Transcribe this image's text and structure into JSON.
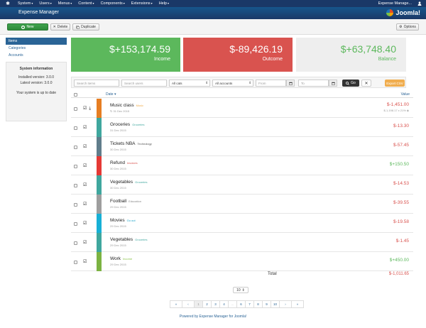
{
  "menubar": {
    "items": [
      "System",
      "Users",
      "Menus",
      "Content",
      "Components",
      "Extensions",
      "Help"
    ],
    "right_label": "Expense Manage..."
  },
  "titlebar": {
    "title": "Expense Manager",
    "brand": "Joomla!"
  },
  "toolbar": {
    "new": "New",
    "delete": "Delete",
    "duplicate": "Duplicate",
    "options": "Options"
  },
  "sidebar": {
    "items": [
      "Items",
      "Categories",
      "Accounts"
    ],
    "system_info": {
      "heading": "System information",
      "installed": "Installed version: 3.0.0",
      "latest": "Latest version: 3.0.0",
      "status": "Your system is up to date"
    }
  },
  "summary": {
    "income": {
      "amount": "$+153,174.59",
      "label": "Income"
    },
    "outcome": {
      "amount": "$-89,426.19",
      "label": "Outcome"
    },
    "balance": {
      "amount": "$+63,748.40",
      "label": "Balance"
    }
  },
  "filters": {
    "search_items_placeholder": "Search items",
    "search_users_placeholder": "Search users",
    "cats_value": "All cats",
    "accounts_value": "All accounts",
    "from_placeholder": "From",
    "to_placeholder": "To",
    "go": "Go",
    "export": "Export CSV"
  },
  "table": {
    "date_header": "Date",
    "value_header": "Value",
    "rows": [
      {
        "name": "Music class",
        "category": "Music",
        "cat_color": "#f0ad4e",
        "bar_color": "#e67e22",
        "date": "31 Dec 2015",
        "value": "$-1,451.00",
        "sign": "neg",
        "sub": "$-1,198.17 x 21%"
      },
      {
        "name": "Groceries",
        "category": "Groceries",
        "cat_color": "#3fa79e",
        "bar_color": "#3fa79e",
        "date": "31 Dec 2015",
        "value": "$-13.30",
        "sign": "neg"
      },
      {
        "name": "Tickets NBA",
        "category": "Technology",
        "cat_color": "#555555",
        "bar_color": "#607d8b",
        "date": "30 Dec 2015",
        "value": "$-57.45",
        "sign": "neg"
      },
      {
        "name": "Refund",
        "category": "Invoices",
        "cat_color": "#d9534f",
        "bar_color": "#e53935",
        "date": "30 Dec 2015",
        "value": "$+150.50",
        "sign": "pos"
      },
      {
        "name": "Vegetables",
        "category": "Groceries",
        "cat_color": "#3fa79e",
        "bar_color": "#3fa79e",
        "date": "30 Dec 2015",
        "value": "$-14.53",
        "sign": "neg"
      },
      {
        "name": "Football",
        "category": "Education",
        "cat_color": "#888888",
        "bar_color": "#9e9e9e",
        "date": "29 Dec 2015",
        "value": "$-39.55",
        "sign": "neg"
      },
      {
        "name": "Movies",
        "category": "Go out",
        "cat_color": "#17a2c8",
        "bar_color": "#17b0d6",
        "date": "29 Dec 2015",
        "value": "$-19.58",
        "sign": "neg"
      },
      {
        "name": "Vegetables",
        "category": "Groceries",
        "cat_color": "#3fa79e",
        "bar_color": "#3fa79e",
        "date": "29 Dec 2015",
        "value": "$-1.45",
        "sign": "neg"
      },
      {
        "name": "Work",
        "category": "Income",
        "cat_color": "#8bc34a",
        "bar_color": "#7cb342",
        "date": "29 Dec 2015",
        "value": "$+450.00",
        "sign": "pos"
      }
    ],
    "total_label": "Total",
    "total_value": "$-1,011.65"
  },
  "limit": "10",
  "pagination": [
    "«",
    "‹",
    "1",
    "2",
    "3",
    "4",
    "...",
    "6",
    "7",
    "8",
    "9",
    "10",
    "›",
    "»"
  ],
  "pagination_active": "1",
  "footer": "Powered by Expense Manager for Joomla!"
}
